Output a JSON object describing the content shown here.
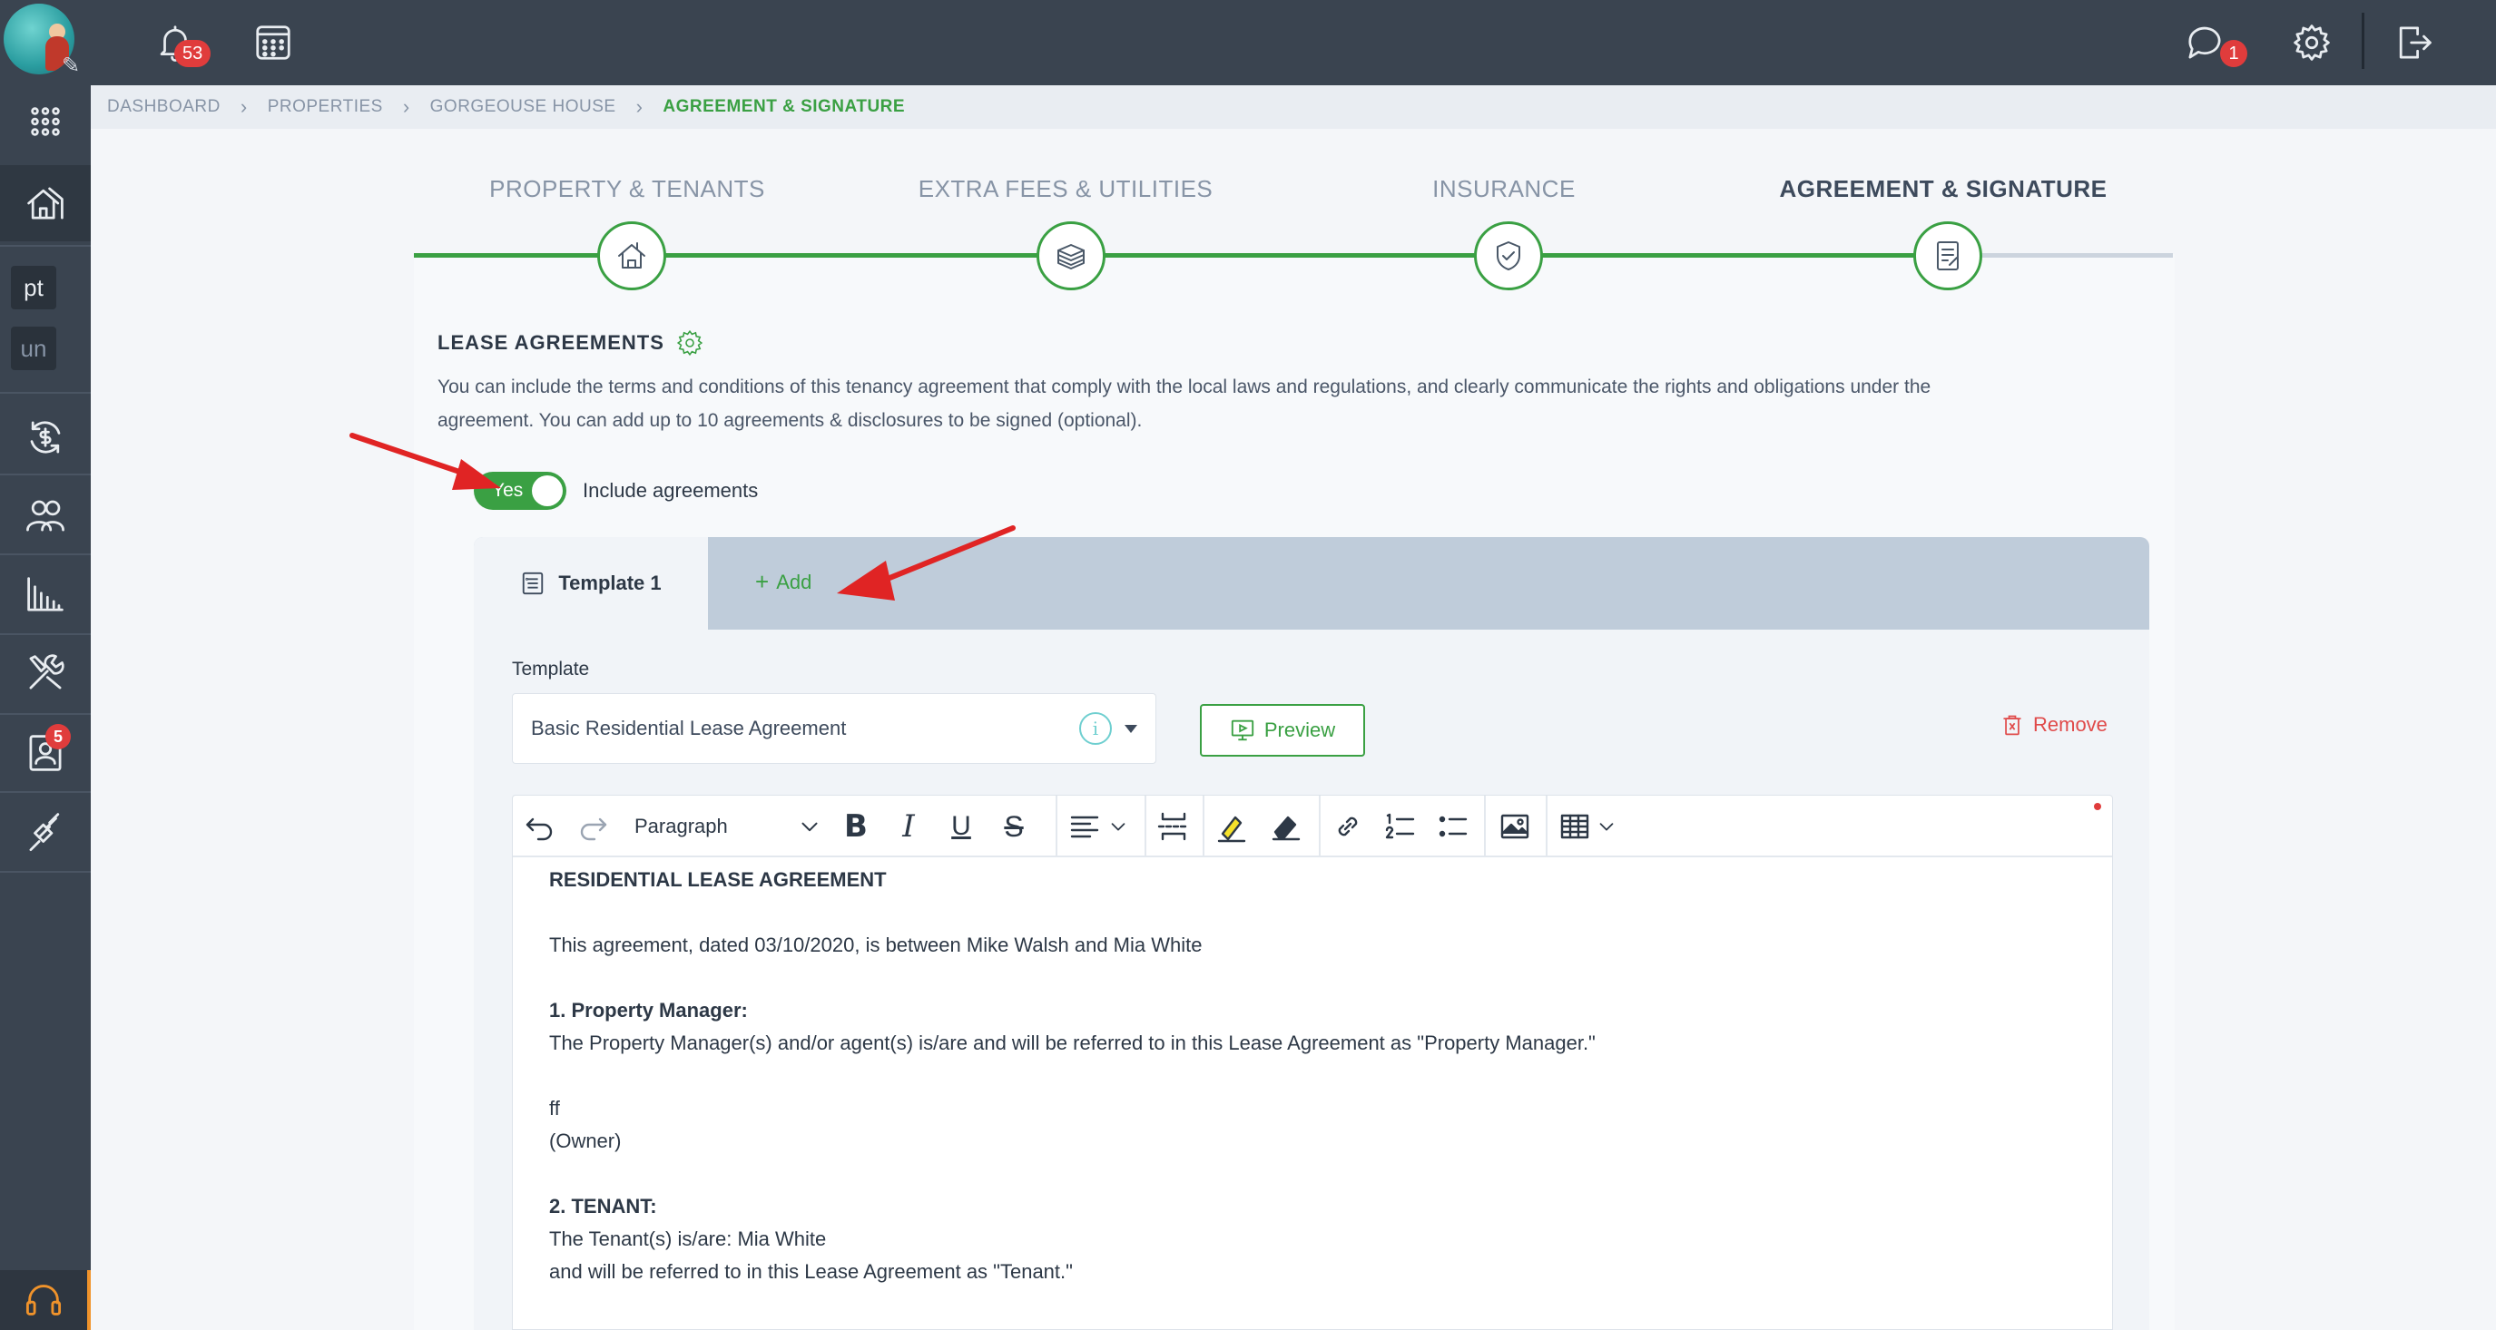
{
  "topbar": {
    "notifications_count": "53",
    "messages_count": "1"
  },
  "sidebar": {
    "chip_pt": "pt",
    "chip_un": "un",
    "contacts_badge": "5"
  },
  "breadcrumb": [
    "DASHBOARD",
    "PROPERTIES",
    "GORGEOUSE HOUSE",
    "AGREEMENT & SIGNATURE"
  ],
  "steps": [
    {
      "label": "PROPERTY & TENANTS",
      "icon": "house-icon"
    },
    {
      "label": "EXTRA FEES & UTILITIES",
      "icon": "money-icon"
    },
    {
      "label": "INSURANCE",
      "icon": "shield-icon"
    },
    {
      "label": "AGREEMENT & SIGNATURE",
      "icon": "document-icon"
    }
  ],
  "lease": {
    "title": "LEASE AGREEMENTS",
    "description_line1": "You can include the terms and conditions of this tenancy agreement that comply with the local laws and regulations, and clearly communicate the rights and obligations under the",
    "description_line2": "agreement. You can add up to 10 agreements & disclosures to be signed (optional).",
    "toggle_value": "Yes",
    "toggle_label": "Include agreements"
  },
  "tabs": {
    "active": "Template 1",
    "add": "Add"
  },
  "template": {
    "label": "Template",
    "selected": "Basic Residential Lease Agreement",
    "preview": "Preview",
    "remove": "Remove"
  },
  "editor": {
    "block_format": "Paragraph",
    "content": {
      "heading": "RESIDENTIAL LEASE AGREEMENT",
      "intro": "This agreement, dated 03/10/2020, is between Mike Walsh and Mia White",
      "s1_title": "1. Property Manager:",
      "s1_text": "The Property Manager(s) and/or agent(s) is/are and will be referred to in this Lease Agreement as \"Property Manager.\"",
      "owner_name": "ff",
      "owner_role": "(Owner)",
      "s2_title": "2. TENANT:",
      "s2_text": "The Tenant(s) is/are: Mia White",
      "s2_text2": "and will be referred to in this Lease Agreement as \"Tenant.\""
    }
  },
  "colors": {
    "accent": "#3aa043",
    "danger": "#e04a4a",
    "sidebar": "#3a4450"
  }
}
